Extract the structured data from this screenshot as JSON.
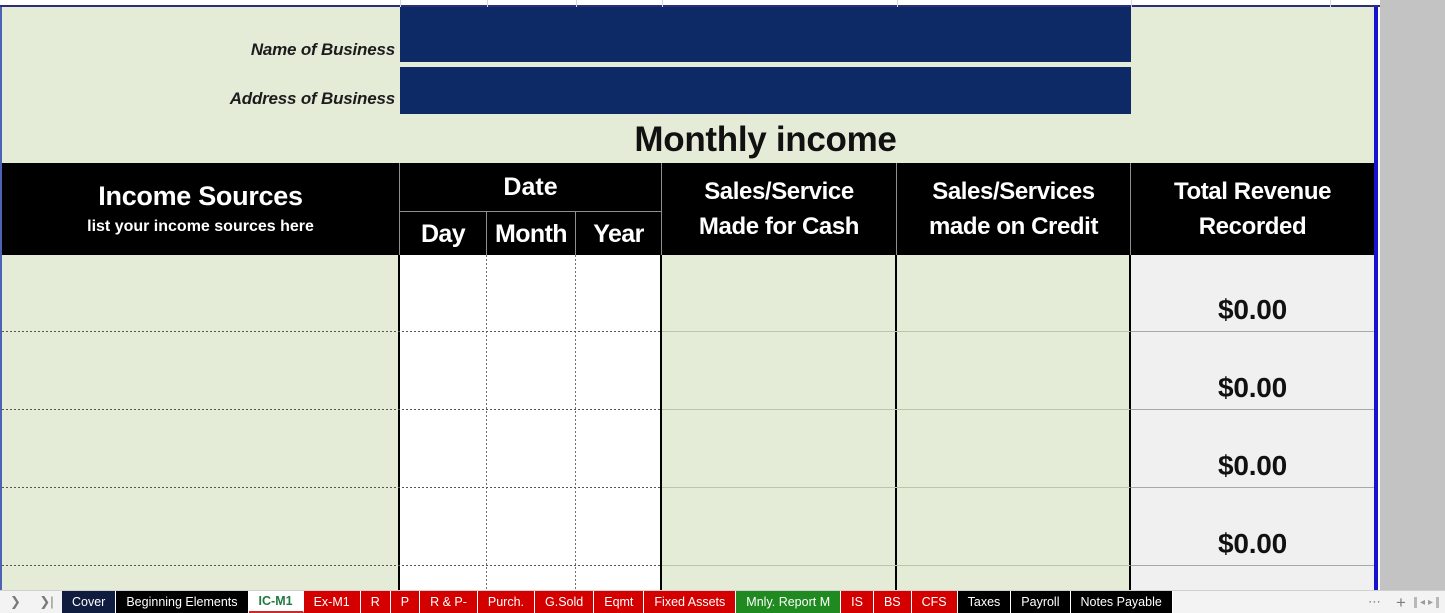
{
  "header": {
    "name_label": "Name of Business",
    "address_label": "Address of Business",
    "name_value": "",
    "address_value": "",
    "title": "Monthly income"
  },
  "table": {
    "columns": {
      "income_sources": "Income Sources",
      "income_sources_sub": "list your income sources here",
      "date": "Date",
      "day": "Day",
      "month": "Month",
      "year": "Year",
      "cash_line1": "Sales/Service",
      "cash_line2": "Made for Cash",
      "credit_line1": "Sales/Services",
      "credit_line2": "made on Credit",
      "total_line1": "Total Revenue",
      "total_line2": "Recorded"
    },
    "rows": [
      {
        "income_source": "",
        "day": "",
        "month": "",
        "year": "",
        "cash": "",
        "credit": "",
        "total": "$0.00"
      },
      {
        "income_source": "",
        "day": "",
        "month": "",
        "year": "",
        "cash": "",
        "credit": "",
        "total": "$0.00"
      },
      {
        "income_source": "",
        "day": "",
        "month": "",
        "year": "",
        "cash": "",
        "credit": "",
        "total": "$0.00"
      },
      {
        "income_source": "",
        "day": "",
        "month": "",
        "year": "",
        "cash": "",
        "credit": "",
        "total": "$0.00"
      },
      {
        "income_source": "",
        "day": "",
        "month": "",
        "year": "",
        "cash": "",
        "credit": "",
        "total": ""
      }
    ]
  },
  "tabbar": {
    "nav_next_icon": "chevron-right-icon",
    "nav_last_icon": "chevron-last-icon",
    "more_icon": "ellipsis-icon",
    "add_sheet_icon": "plus-icon",
    "scroll_left_icon": "scroll-left-icon",
    "scroll_right_icon": "scroll-right-icon",
    "tabs": [
      {
        "label": "Cover",
        "style": "navy",
        "active": false
      },
      {
        "label": "Beginning Elements",
        "style": "black",
        "active": false
      },
      {
        "label": "IC-M1",
        "style": "active",
        "active": true
      },
      {
        "label": "Ex-M1",
        "style": "red",
        "active": false
      },
      {
        "label": "R",
        "style": "red",
        "active": false
      },
      {
        "label": "P",
        "style": "red",
        "active": false
      },
      {
        "label": "R & P-",
        "style": "red",
        "active": false
      },
      {
        "label": "Purch.",
        "style": "red",
        "active": false
      },
      {
        "label": "G.Sold",
        "style": "red",
        "active": false
      },
      {
        "label": "Eqmt",
        "style": "red",
        "active": false
      },
      {
        "label": "Fixed Assets",
        "style": "red",
        "active": false
      },
      {
        "label": "Mnly. Report M",
        "style": "green",
        "active": false
      },
      {
        "label": "IS",
        "style": "red",
        "active": false
      },
      {
        "label": "BS",
        "style": "red",
        "active": false
      },
      {
        "label": "CFS",
        "style": "red",
        "active": false
      },
      {
        "label": "Taxes",
        "style": "black",
        "active": false
      },
      {
        "label": "Payroll",
        "style": "black",
        "active": false
      },
      {
        "label": "Notes Payable",
        "style": "black",
        "active": false
      }
    ]
  },
  "colors": {
    "sheet_bg": "#e4ecd8",
    "header_band": "#000000",
    "field_navy": "#0e2a66",
    "tab_red": "#d40000",
    "tab_green": "#1f8a1f",
    "selection_blue": "#1414cf",
    "total_col_bg": "#f0f0f0"
  }
}
